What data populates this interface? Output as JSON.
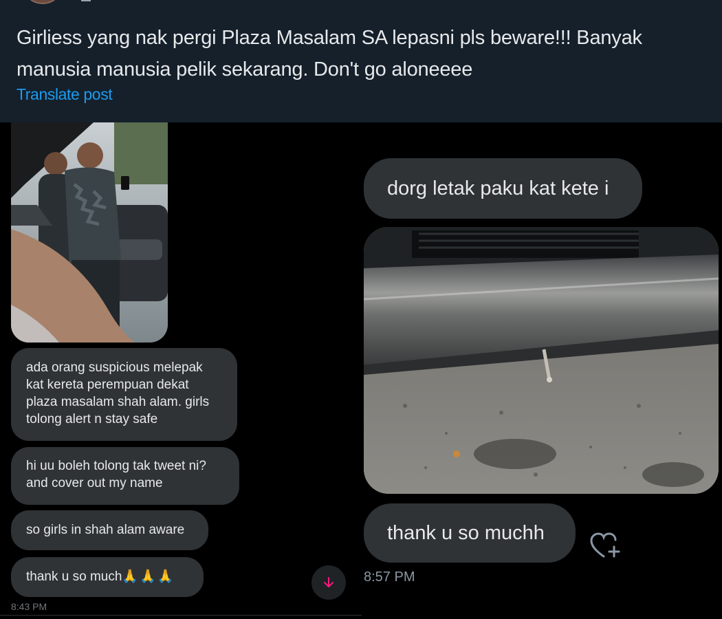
{
  "tweet": {
    "text": "Girliess yang nak pergi Plaza Masalam SA lepasni pls beware!!! Banyak manusia manusia pelik sekarang. Don't go aloneeee",
    "translate_label": "Translate post"
  },
  "left_chat": {
    "messages": [
      {
        "text": "ada orang suspicious melepak kat kereta perempuan dekat plaza masalam shah alam. girls tolong alert n stay safe"
      },
      {
        "text": "hi uu boleh tolong tak tweet ni? and cover out my name"
      },
      {
        "text": "so girls in shah alam aware"
      },
      {
        "text": "thank u so much",
        "emoji": "🙏🙏🙏"
      }
    ],
    "timestamp": "8:43 PM"
  },
  "right_chat": {
    "messages": [
      {
        "text": "dorg letak paku kat kete i"
      },
      {
        "text": "thank u so muchh"
      }
    ],
    "timestamp": "8:57 PM"
  },
  "icons": {
    "scroll_down": "arrow-down-icon",
    "reaction": "heart-plus-icon"
  },
  "colors": {
    "header_bg": "#15202b",
    "bubble_bg": "#2f3336",
    "link": "#1d9bf0",
    "accent_pink": "#f91880"
  }
}
